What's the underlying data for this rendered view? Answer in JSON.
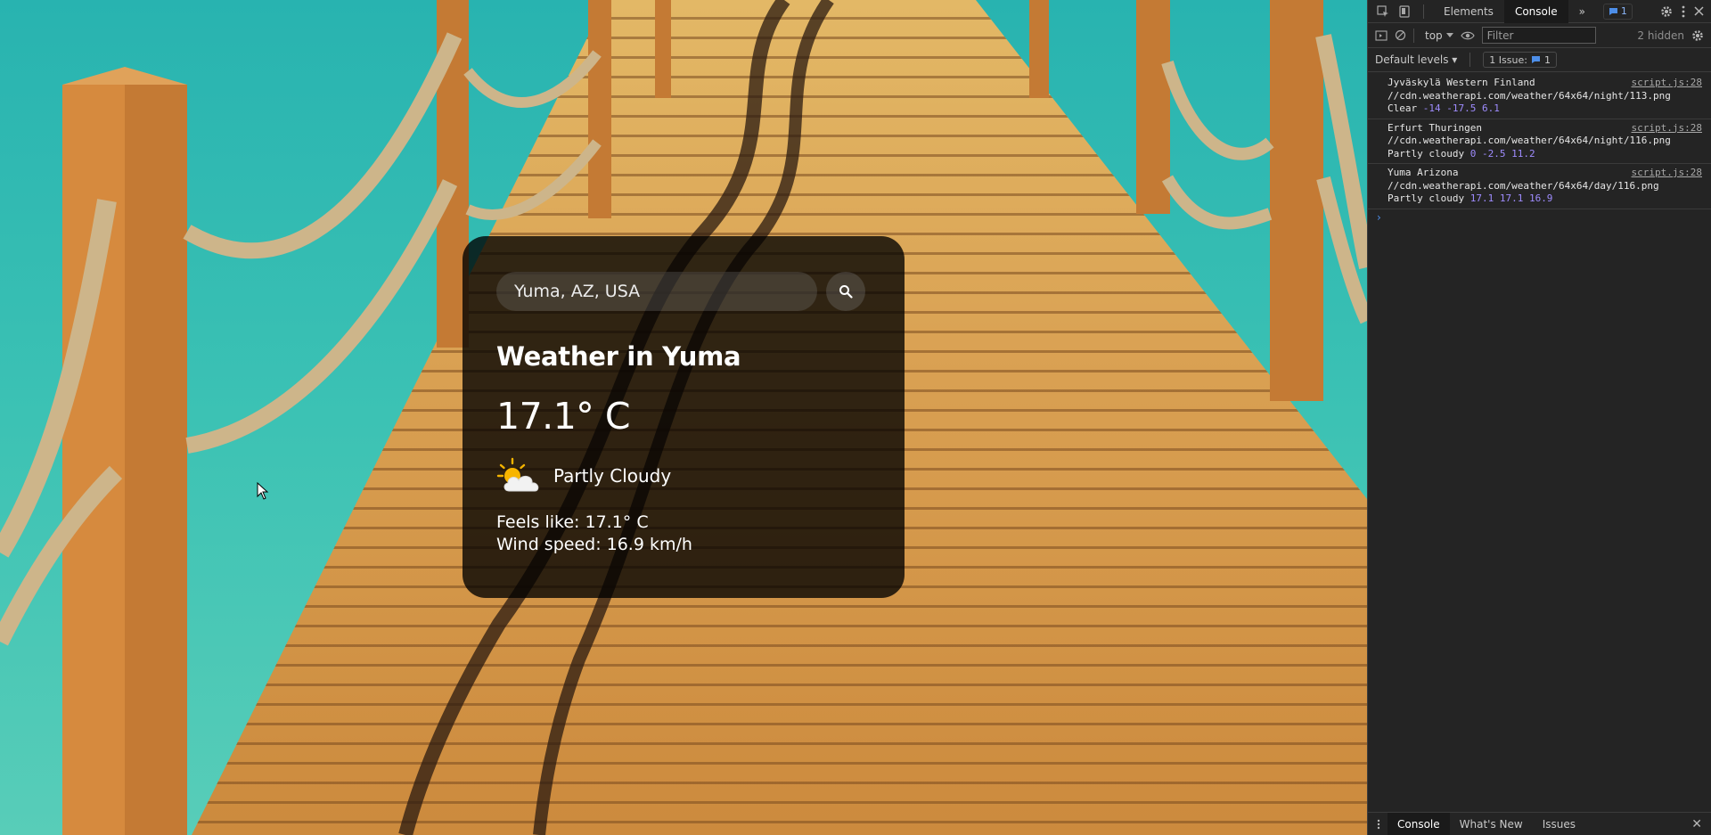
{
  "weather": {
    "search_value": "Yuma, AZ, USA",
    "search_placeholder": "Search",
    "city_title": "Weather in Yuma",
    "temperature": "17.1° C",
    "condition": "Partly Cloudy",
    "condition_icon": "partly-cloudy-icon",
    "feels_like": "Feels like: 17.1° C",
    "wind_speed": "Wind speed: 16.9 km/h"
  },
  "devtools": {
    "tabs": {
      "elements": "Elements",
      "console": "Console",
      "more": "»"
    },
    "issue_badge_count": "1",
    "context": "top",
    "filter_placeholder": "Filter",
    "hidden": "2 hidden",
    "levels": "Default levels",
    "issues_label": "1 Issue:",
    "issues_count": "1",
    "messages": [
      {
        "line1": "Jyväskylä Western Finland",
        "line2": "//cdn.weatherapi.com/weather/64x64/night/113.png",
        "text": "Clear",
        "nums": "-14 -17.5 6.1",
        "source": "script.js:28"
      },
      {
        "line1": "Erfurt Thuringen",
        "line2": "//cdn.weatherapi.com/weather/64x64/night/116.png",
        "text": "Partly cloudy",
        "nums": "0 -2.5 11.2",
        "source": "script.js:28"
      },
      {
        "line1": "Yuma Arizona",
        "line2": "//cdn.weatherapi.com/weather/64x64/day/116.png",
        "text": "Partly cloudy",
        "nums": "17.1 17.1 16.9",
        "source": "script.js:28"
      }
    ],
    "prompt": "›",
    "drawer_tabs": [
      "Console",
      "What's New",
      "Issues"
    ]
  }
}
